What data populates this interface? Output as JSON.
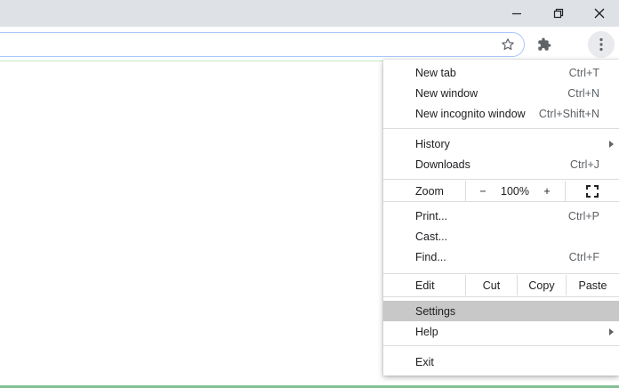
{
  "window": {
    "icons": {
      "minimize": "minimize-icon",
      "restore": "restore-icon",
      "close": "close-icon"
    }
  },
  "toolbar": {
    "icons": {
      "bookmark": "star-icon",
      "extensions": "puzzle-icon",
      "menu": "kebab-icon"
    }
  },
  "menu": {
    "new_tab": {
      "label": "New tab",
      "shortcut": "Ctrl+T"
    },
    "new_window": {
      "label": "New window",
      "shortcut": "Ctrl+N"
    },
    "new_incognito": {
      "label": "New incognito window",
      "shortcut": "Ctrl+Shift+N"
    },
    "history": {
      "label": "History"
    },
    "downloads": {
      "label": "Downloads",
      "shortcut": "Ctrl+J"
    },
    "zoom": {
      "label": "Zoom",
      "minus": "−",
      "level": "100%",
      "plus": "+"
    },
    "print": {
      "label": "Print...",
      "shortcut": "Ctrl+P"
    },
    "cast": {
      "label": "Cast..."
    },
    "find": {
      "label": "Find...",
      "shortcut": "Ctrl+F"
    },
    "edit": {
      "label": "Edit",
      "cut": "Cut",
      "copy": "Copy",
      "paste": "Paste"
    },
    "settings": {
      "label": "Settings"
    },
    "help": {
      "label": "Help"
    },
    "exit": {
      "label": "Exit"
    }
  },
  "colors": {
    "titlebar": "#dee1e6",
    "highlight": "#c8c8c8",
    "omnibox_border": "#a8c7fa",
    "bottom_line": "#1e8e3e"
  }
}
